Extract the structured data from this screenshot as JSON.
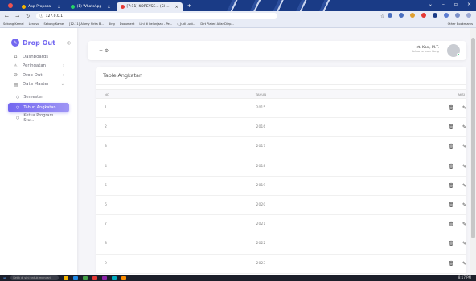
{
  "browser": {
    "tabs": [
      {
        "label": "App Proposal",
        "active": false,
        "color": "#f4b400"
      },
      {
        "label": "(1) WhatsApp",
        "active": false,
        "color": "#25d366"
      },
      {
        "label": "[7:11] KOREYSE... (SI ...",
        "active": true,
        "color": "#e53935"
      }
    ],
    "url": "127.0.0.1",
    "bookmarks": [
      "Sekong Kamel",
      "Lenovo",
      "Sekong Kamel",
      "[12.11] Alamy Sirka B...",
      "Bing",
      "Document",
      "Lini di belanjaan - Pe...",
      "4_Judi Lunt...",
      "Dirt Plated Alfar Diep..."
    ],
    "all_bookmarks": "Other Bookmarks"
  },
  "sidebar": {
    "brand": "Drop Out",
    "items": [
      {
        "label": "Dashboards",
        "icon": "home-icon",
        "glyph": "⌂"
      },
      {
        "label": "Peringatan",
        "icon": "alert-icon",
        "glyph": "⚠",
        "chevron": true
      },
      {
        "label": "Drop Out",
        "icon": "user-x-icon",
        "glyph": "⊘",
        "chevron": true
      },
      {
        "label": "Data Master",
        "icon": "database-icon",
        "glyph": "▤",
        "chevron": true
      }
    ],
    "subitems": [
      {
        "label": "Semester",
        "active": false
      },
      {
        "label": "Tahun Angkatan",
        "active": true
      },
      {
        "label": "Ketua Program Stu...",
        "active": false
      }
    ]
  },
  "topnav": {
    "add_label": "+ ⚙",
    "user_name": "rt. Kasi, M.T.",
    "user_role": "Ketua Jurusan Kong"
  },
  "card": {
    "title": "Table Angkatan",
    "columns": [
      "NO",
      "TAHUN",
      "AKSI"
    ],
    "rows": [
      {
        "no": "1",
        "year": "2015"
      },
      {
        "no": "2",
        "year": "2016"
      },
      {
        "no": "3",
        "year": "2017"
      },
      {
        "no": "4",
        "year": "2018"
      },
      {
        "no": "5",
        "year": "2019"
      },
      {
        "no": "6",
        "year": "2020"
      },
      {
        "no": "7",
        "year": "2021"
      },
      {
        "no": "8",
        "year": "2022"
      },
      {
        "no": "9",
        "year": "2023"
      }
    ]
  },
  "taskbar": {
    "search": "Ketik di sini untuk mencari",
    "clock": "8:17 PM"
  }
}
